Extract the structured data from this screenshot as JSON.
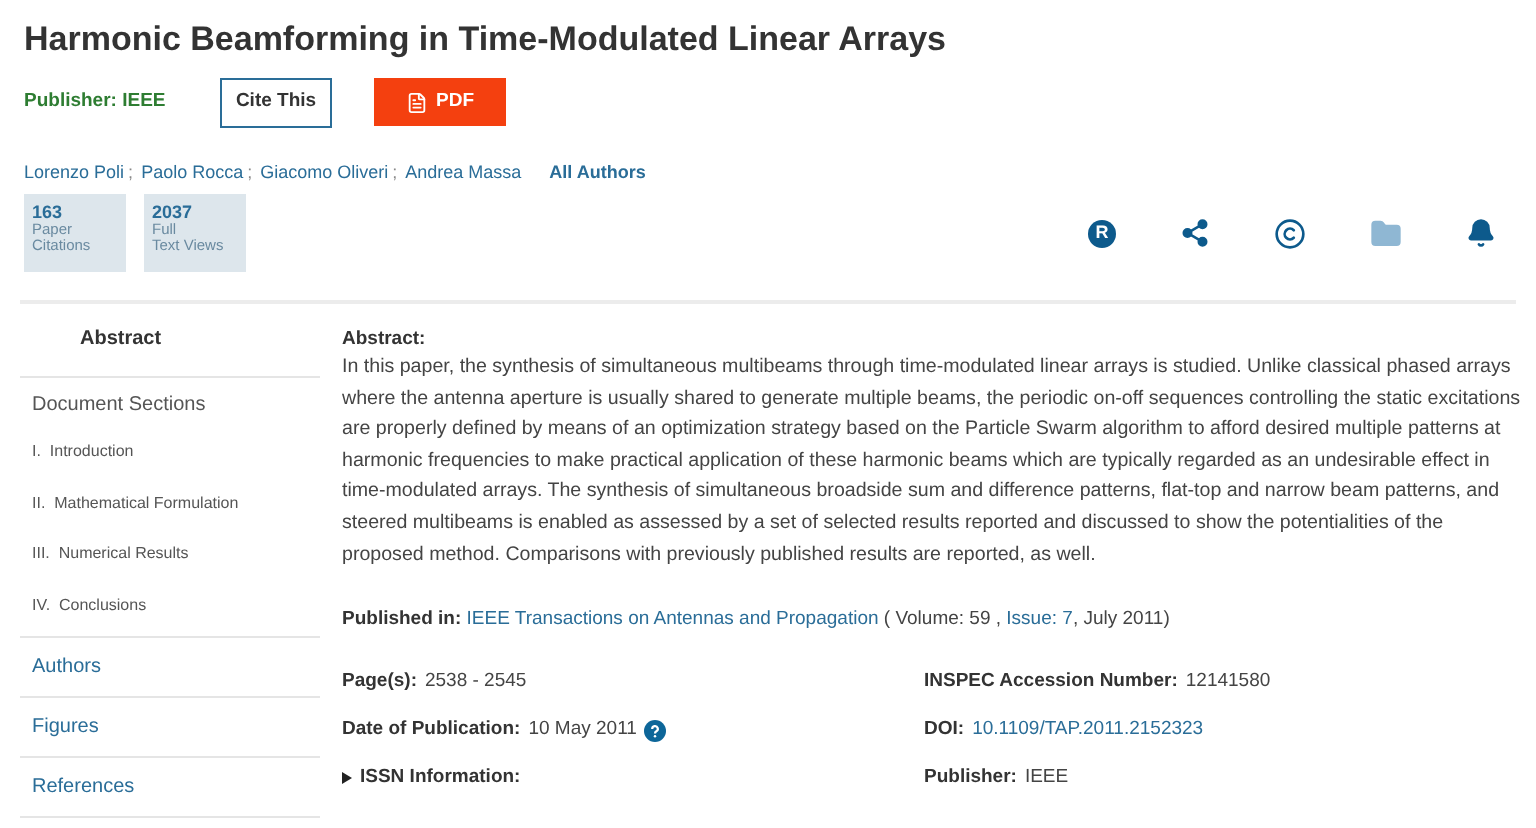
{
  "title": "Harmonic Beamforming in Time-Modulated Linear Arrays",
  "publisher": {
    "label": "Publisher:",
    "value": "IEEE"
  },
  "buttons": [
    {
      "kind": "outline",
      "label": "Cite This"
    },
    {
      "kind": "pdf",
      "label": "PDF"
    }
  ],
  "authors": [
    {
      "name": "Lorenzo Poli",
      "sep": ";"
    },
    {
      "name": "Paolo Rocca",
      "sep": ";"
    },
    {
      "name": "Giacomo Oliveri",
      "sep": ";"
    },
    {
      "name": "Andrea Massa"
    }
  ],
  "all_authors": "All Authors",
  "metrics": [
    {
      "value": "163",
      "lines": [
        "Paper",
        "Citations"
      ]
    },
    {
      "value": "2037",
      "lines": [
        "Full",
        "Text Views"
      ]
    }
  ],
  "actions": [
    {
      "kind": "rights",
      "glyph": "R"
    },
    {
      "kind": "share"
    },
    {
      "kind": "copyright"
    },
    {
      "kind": "folder"
    },
    {
      "kind": "alert"
    }
  ],
  "sidebar": [
    {
      "kind": "tab",
      "label": "Abstract",
      "selected": true
    },
    {
      "kind": "heading",
      "label": "Document Sections"
    },
    {
      "kind": "section",
      "number": "I.",
      "label": "Introduction"
    },
    {
      "kind": "section",
      "number": "II.",
      "label": "Mathematical Formulation"
    },
    {
      "kind": "section",
      "number": "III.",
      "label": "Numerical Results"
    },
    {
      "kind": "section",
      "number": "IV.",
      "label": "Conclusions"
    },
    {
      "kind": "tab",
      "label": "Authors",
      "selected": false
    },
    {
      "kind": "tab",
      "label": "Figures",
      "selected": false
    },
    {
      "kind": "tab",
      "label": "References",
      "selected": false
    }
  ],
  "abstract": {
    "heading": "Abstract:",
    "text": "In this paper, the synthesis of simultaneous multibeams through time-modulated linear arrays is studied. Unlike classical phased arrays where the antenna aperture is usually shared to generate multiple beams, the periodic on-off sequences controlling the static excitations are properly defined by means of an optimization strategy based on the Particle Swarm algorithm to afford desired multiple patterns at harmonic frequencies to make practical application of these harmonic beams which are typically regarded as an undesirable effect in time-modulated arrays. The synthesis of simultaneous broadside sum and difference patterns, flat-top and narrow beam patterns, and steered multibeams is enabled as assessed by a set of selected results reported and discussed to show the potentialities of the proposed method. Comparisons with previously published results are reported, as well."
  },
  "published_in": {
    "label": "Published in:",
    "journal": "IEEE Transactions on Antennas and Propagation",
    "volume": "( Volume: 59 ,",
    "issue": "Issue: 7",
    "date": ", July 2011)"
  },
  "details": [
    {
      "label": "Page(s):",
      "value": "2538 - 2545",
      "kind": "text"
    },
    {
      "label": "INSPEC Accession Number:",
      "value": "12141580",
      "kind": "text"
    },
    {
      "label": "Date of Publication:",
      "value": "10 May 2011",
      "kind": "help"
    },
    {
      "label": "DOI:",
      "value": "10.1109/TAP.2011.2152323",
      "kind": "link"
    },
    {
      "label": "ISSN Information:",
      "kind": "toggle",
      "expanded": false
    },
    {
      "label": "Publisher:",
      "value": "IEEE",
      "kind": "text"
    }
  ]
}
